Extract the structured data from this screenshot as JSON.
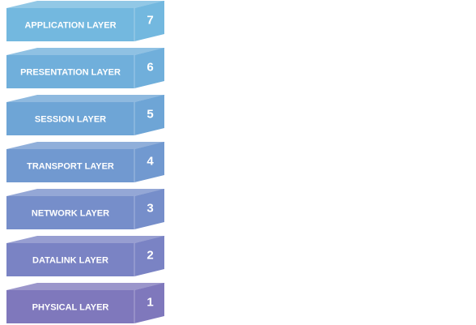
{
  "layers": [
    {
      "label": "APPLICATION LAYER",
      "number": "7",
      "color": "#73B8DF"
    },
    {
      "label": "PRESENTATION LAYER",
      "number": "6",
      "color": "#70AFDB"
    },
    {
      "label": "SESSION LAYER",
      "number": "5",
      "color": "#6EA5D6"
    },
    {
      "label": "TRANSPORT LAYER",
      "number": "4",
      "color": "#7199D0"
    },
    {
      "label": "NETWORK LAYER",
      "number": "3",
      "color": "#768ECA"
    },
    {
      "label": "DATALINK LAYER",
      "number": "2",
      "color": "#7A83C4"
    },
    {
      "label": "PHYSICAL LAYER",
      "number": "1",
      "color": "#7F78BC"
    }
  ]
}
